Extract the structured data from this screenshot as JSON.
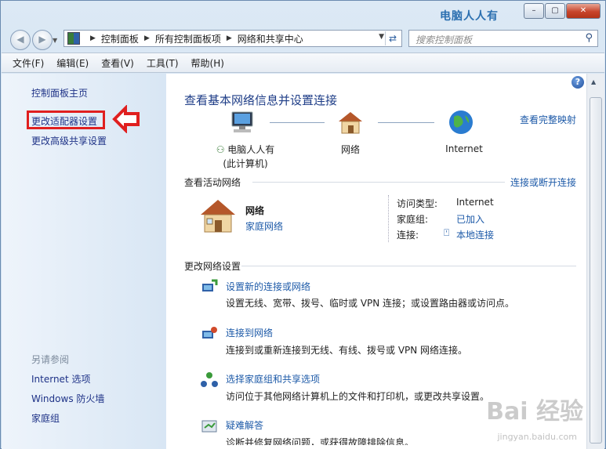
{
  "window": {
    "title_mark": "电脑人人有",
    "buttons": {
      "min": "–",
      "max": "▢",
      "close": "✕"
    }
  },
  "nav": {
    "breadcrumb": [
      "控制面板",
      "所有控制面板项",
      "网络和共享中心"
    ],
    "search_placeholder": "搜索控制面板"
  },
  "menu": [
    "文件(F)",
    "编辑(E)",
    "查看(V)",
    "工具(T)",
    "帮助(H)"
  ],
  "sidebar": {
    "home": "控制面板主页",
    "change_adapter": "更改适配器设置",
    "advanced_sharing": "更改高级共享设置",
    "see_also_header": "另请参阅",
    "see_also": [
      "Internet 选项",
      "Windows 防火墙",
      "家庭组"
    ]
  },
  "main": {
    "title": "查看基本网络信息并设置连接",
    "full_map": "查看完整映射",
    "nodes": {
      "computer": "电脑人人有",
      "computer_sub": "(此计算机)",
      "network": "网络",
      "internet": "Internet"
    },
    "active_header": "查看活动网络",
    "connect_disconnect": "连接或断开连接",
    "active": {
      "name": "网络",
      "type": "家庭网络",
      "access_label": "访问类型:",
      "access_value": "Internet",
      "homegroup_label": "家庭组:",
      "homegroup_value": "已加入",
      "conn_label": "连接:",
      "conn_value": "本地连接"
    },
    "change_header": "更改网络设置",
    "tasks": [
      {
        "title": "设置新的连接或网络",
        "desc": "设置无线、宽带、拨号、临时或 VPN 连接；或设置路由器或访问点。"
      },
      {
        "title": "连接到网络",
        "desc": "连接到或重新连接到无线、有线、拨号或 VPN 网络连接。"
      },
      {
        "title": "选择家庭组和共享选项",
        "desc": "访问位于其他网络计算机上的文件和打印机，或更改共享设置。"
      },
      {
        "title": "疑难解答",
        "desc": "诊断并修复网络问题，或获得故障排除信息。"
      }
    ]
  },
  "watermark": {
    "brand": "Bai 经验",
    "url": "jingyan.baidu.com"
  }
}
